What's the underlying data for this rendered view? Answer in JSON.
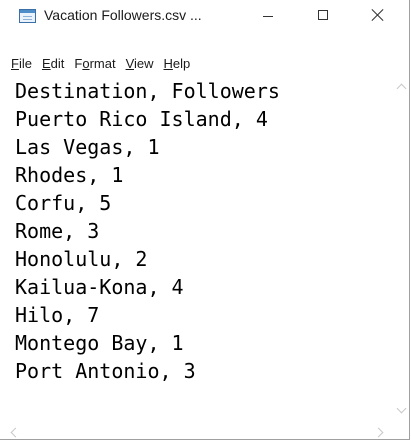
{
  "window": {
    "title": "Vacation Followers.csv ...",
    "icon": "notepad-icon"
  },
  "menu": {
    "items": [
      {
        "key": "F",
        "rest": "ile"
      },
      {
        "key": "E",
        "rest": "dit"
      },
      {
        "pre": "F",
        "key": "o",
        "rest": "rmat"
      },
      {
        "key": "V",
        "rest": "iew"
      },
      {
        "key": "H",
        "rest": "elp"
      }
    ]
  },
  "editor": {
    "lines": [
      "Destination, Followers",
      "Puerto Rico Island, 4",
      "Las Vegas, 1",
      "Rhodes, 1",
      "Corfu, 5",
      "Rome, 3",
      "Honolulu, 2",
      "Kailua-Kona, 4",
      "Hilo, 7",
      "Montego Bay, 1",
      "Port Antonio, 3"
    ]
  },
  "colors": {
    "text": "#000000",
    "background": "#ffffff"
  }
}
